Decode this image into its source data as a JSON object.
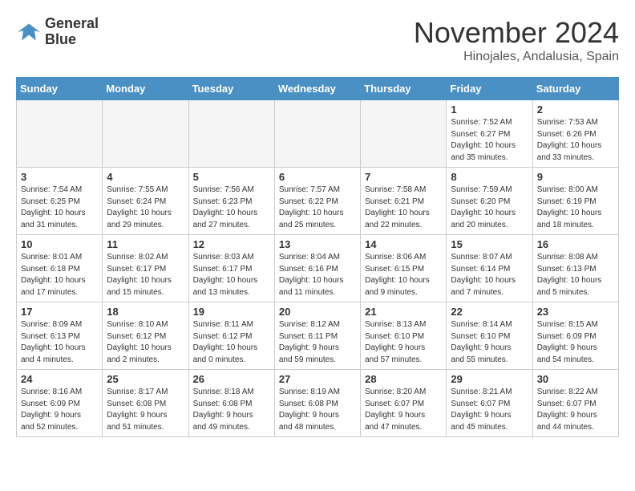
{
  "logo": {
    "line1": "General",
    "line2": "Blue"
  },
  "title": "November 2024",
  "location": "Hinojales, Andalusia, Spain",
  "weekdays": [
    "Sunday",
    "Monday",
    "Tuesday",
    "Wednesday",
    "Thursday",
    "Friday",
    "Saturday"
  ],
  "weeks": [
    [
      {
        "day": "",
        "info": ""
      },
      {
        "day": "",
        "info": ""
      },
      {
        "day": "",
        "info": ""
      },
      {
        "day": "",
        "info": ""
      },
      {
        "day": "",
        "info": ""
      },
      {
        "day": "1",
        "info": "Sunrise: 7:52 AM\nSunset: 6:27 PM\nDaylight: 10 hours\nand 35 minutes."
      },
      {
        "day": "2",
        "info": "Sunrise: 7:53 AM\nSunset: 6:26 PM\nDaylight: 10 hours\nand 33 minutes."
      }
    ],
    [
      {
        "day": "3",
        "info": "Sunrise: 7:54 AM\nSunset: 6:25 PM\nDaylight: 10 hours\nand 31 minutes."
      },
      {
        "day": "4",
        "info": "Sunrise: 7:55 AM\nSunset: 6:24 PM\nDaylight: 10 hours\nand 29 minutes."
      },
      {
        "day": "5",
        "info": "Sunrise: 7:56 AM\nSunset: 6:23 PM\nDaylight: 10 hours\nand 27 minutes."
      },
      {
        "day": "6",
        "info": "Sunrise: 7:57 AM\nSunset: 6:22 PM\nDaylight: 10 hours\nand 25 minutes."
      },
      {
        "day": "7",
        "info": "Sunrise: 7:58 AM\nSunset: 6:21 PM\nDaylight: 10 hours\nand 22 minutes."
      },
      {
        "day": "8",
        "info": "Sunrise: 7:59 AM\nSunset: 6:20 PM\nDaylight: 10 hours\nand 20 minutes."
      },
      {
        "day": "9",
        "info": "Sunrise: 8:00 AM\nSunset: 6:19 PM\nDaylight: 10 hours\nand 18 minutes."
      }
    ],
    [
      {
        "day": "10",
        "info": "Sunrise: 8:01 AM\nSunset: 6:18 PM\nDaylight: 10 hours\nand 17 minutes."
      },
      {
        "day": "11",
        "info": "Sunrise: 8:02 AM\nSunset: 6:17 PM\nDaylight: 10 hours\nand 15 minutes."
      },
      {
        "day": "12",
        "info": "Sunrise: 8:03 AM\nSunset: 6:17 PM\nDaylight: 10 hours\nand 13 minutes."
      },
      {
        "day": "13",
        "info": "Sunrise: 8:04 AM\nSunset: 6:16 PM\nDaylight: 10 hours\nand 11 minutes."
      },
      {
        "day": "14",
        "info": "Sunrise: 8:06 AM\nSunset: 6:15 PM\nDaylight: 10 hours\nand 9 minutes."
      },
      {
        "day": "15",
        "info": "Sunrise: 8:07 AM\nSunset: 6:14 PM\nDaylight: 10 hours\nand 7 minutes."
      },
      {
        "day": "16",
        "info": "Sunrise: 8:08 AM\nSunset: 6:13 PM\nDaylight: 10 hours\nand 5 minutes."
      }
    ],
    [
      {
        "day": "17",
        "info": "Sunrise: 8:09 AM\nSunset: 6:13 PM\nDaylight: 10 hours\nand 4 minutes."
      },
      {
        "day": "18",
        "info": "Sunrise: 8:10 AM\nSunset: 6:12 PM\nDaylight: 10 hours\nand 2 minutes."
      },
      {
        "day": "19",
        "info": "Sunrise: 8:11 AM\nSunset: 6:12 PM\nDaylight: 10 hours\nand 0 minutes."
      },
      {
        "day": "20",
        "info": "Sunrise: 8:12 AM\nSunset: 6:11 PM\nDaylight: 9 hours\nand 59 minutes."
      },
      {
        "day": "21",
        "info": "Sunrise: 8:13 AM\nSunset: 6:10 PM\nDaylight: 9 hours\nand 57 minutes."
      },
      {
        "day": "22",
        "info": "Sunrise: 8:14 AM\nSunset: 6:10 PM\nDaylight: 9 hours\nand 55 minutes."
      },
      {
        "day": "23",
        "info": "Sunrise: 8:15 AM\nSunset: 6:09 PM\nDaylight: 9 hours\nand 54 minutes."
      }
    ],
    [
      {
        "day": "24",
        "info": "Sunrise: 8:16 AM\nSunset: 6:09 PM\nDaylight: 9 hours\nand 52 minutes."
      },
      {
        "day": "25",
        "info": "Sunrise: 8:17 AM\nSunset: 6:08 PM\nDaylight: 9 hours\nand 51 minutes."
      },
      {
        "day": "26",
        "info": "Sunrise: 8:18 AM\nSunset: 6:08 PM\nDaylight: 9 hours\nand 49 minutes."
      },
      {
        "day": "27",
        "info": "Sunrise: 8:19 AM\nSunset: 6:08 PM\nDaylight: 9 hours\nand 48 minutes."
      },
      {
        "day": "28",
        "info": "Sunrise: 8:20 AM\nSunset: 6:07 PM\nDaylight: 9 hours\nand 47 minutes."
      },
      {
        "day": "29",
        "info": "Sunrise: 8:21 AM\nSunset: 6:07 PM\nDaylight: 9 hours\nand 45 minutes."
      },
      {
        "day": "30",
        "info": "Sunrise: 8:22 AM\nSunset: 6:07 PM\nDaylight: 9 hours\nand 44 minutes."
      }
    ]
  ]
}
